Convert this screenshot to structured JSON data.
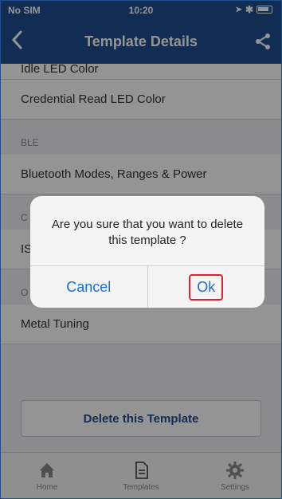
{
  "status": {
    "carrier": "No SIM",
    "time": "10:20"
  },
  "nav": {
    "title": "Template Details"
  },
  "list": {
    "rows_top": [
      "Idle LED Color",
      "Credential Read LED Color"
    ],
    "section_ble": "BLE",
    "ble_row": "Bluetooth Modes, Ranges & Power",
    "section_c": "C",
    "row_is": "IS",
    "section_o": "O",
    "row_metal": "Metal Tuning",
    "delete_label": "Delete this Template"
  },
  "alert": {
    "message": "Are you sure that you want to delete this template ?",
    "cancel_label": "Cancel",
    "ok_label": "Ok"
  },
  "tabbar": {
    "home": "Home",
    "templates": "Templates",
    "settings": "Settings"
  },
  "colors": {
    "nav": "#1f4e8f",
    "alert_button": "#1a6fd0",
    "highlight": "#e3202f"
  },
  "icons": [
    "wifi-icon",
    "location-icon",
    "bluetooth-icon",
    "battery-icon",
    "back-chevron-icon",
    "share-icon",
    "home-icon",
    "templates-icon",
    "settings-icon"
  ]
}
